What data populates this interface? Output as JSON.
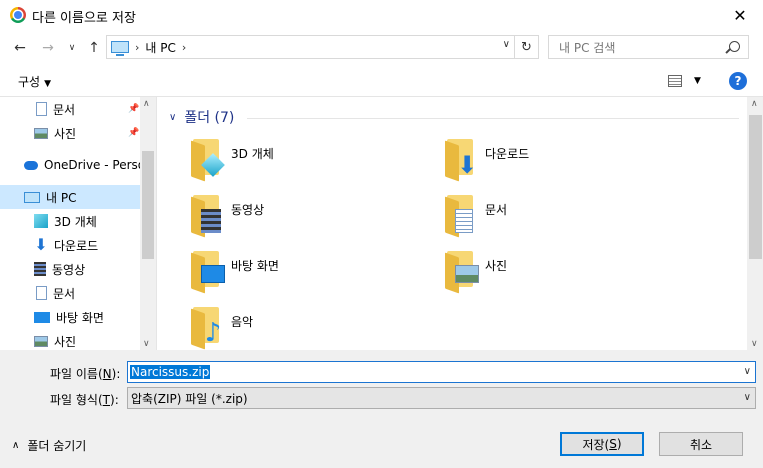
{
  "window": {
    "title": "다른 이름으로 저장",
    "close_label": "✕"
  },
  "addressbar": {
    "breadcrumb": [
      "내 PC"
    ]
  },
  "search": {
    "placeholder": "내 PC 검색"
  },
  "toolbar": {
    "organize_label": "구성",
    "help_label": "?"
  },
  "navpane": {
    "items": [
      {
        "label": "문서",
        "icon": "document-icon",
        "pinned": true
      },
      {
        "label": "사진",
        "icon": "pictures-icon",
        "pinned": true
      },
      {
        "label": "OneDrive - Person",
        "icon": "onedrive-cloud-icon"
      },
      {
        "label": "내 PC",
        "icon": "computer-icon",
        "selected": true
      },
      {
        "label": "3D 개체",
        "icon": "3d-objects-icon"
      },
      {
        "label": "다운로드",
        "icon": "download-arrow-icon"
      },
      {
        "label": "동영상",
        "icon": "video-film-icon"
      },
      {
        "label": "문서",
        "icon": "document-icon"
      },
      {
        "label": "바탕 화면",
        "icon": "desktop-icon"
      },
      {
        "label": "사진",
        "icon": "pictures-icon"
      }
    ]
  },
  "main": {
    "group_title": "폴더 (7)",
    "folders": [
      {
        "label": "3D 개체",
        "icon": "3d-objects-folder-icon"
      },
      {
        "label": "다운로드",
        "icon": "downloads-folder-icon"
      },
      {
        "label": "동영상",
        "icon": "videos-folder-icon"
      },
      {
        "label": "문서",
        "icon": "documents-folder-icon"
      },
      {
        "label": "바탕 화면",
        "icon": "desktop-folder-icon"
      },
      {
        "label": "사진",
        "icon": "pictures-folder-icon"
      },
      {
        "label": "음악",
        "icon": "music-folder-icon"
      }
    ]
  },
  "form": {
    "filename_label": "파일 이름(",
    "filename_key": "N",
    "filename_label_end": "):",
    "filename_value": "Narcissus.zip",
    "filetype_label": "파일 형식(",
    "filetype_key": "T",
    "filetype_label_end": "):",
    "filetype_value": "압축(ZIP) 파일 (*.zip)"
  },
  "footer": {
    "hide_folders_label": "폴더 숨기기",
    "save_label": "저장(",
    "save_key": "S",
    "save_label_end": ")",
    "cancel_label": "취소"
  },
  "colors": {
    "accent": "#0078d7",
    "selection": "#cce8ff",
    "group_title": "#1e3287"
  }
}
